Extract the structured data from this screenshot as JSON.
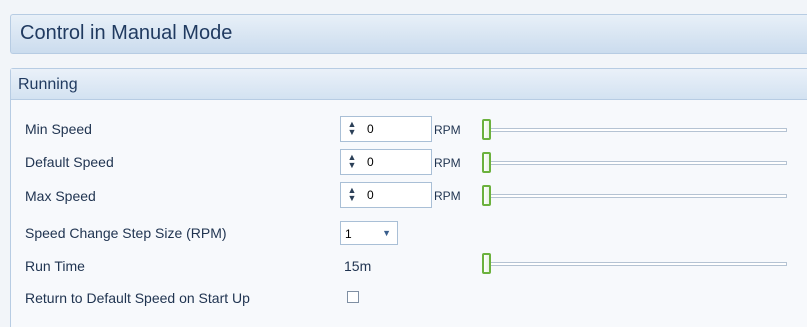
{
  "header": {
    "title": "Control in Manual Mode"
  },
  "section": {
    "title": "Running"
  },
  "rows": [
    {
      "label": "Min Speed",
      "value": "0",
      "unit": "RPM",
      "slider_fraction": 0
    },
    {
      "label": "Default Speed",
      "value": "0",
      "unit": "RPM",
      "slider_fraction": 0
    },
    {
      "label": "Max Speed",
      "value": "0",
      "unit": "RPM",
      "slider_fraction": 0
    }
  ],
  "step_size": {
    "label": "Speed Change Step Size (RPM)",
    "value": "1"
  },
  "run_time": {
    "label": "Run Time",
    "value": "15m",
    "slider_fraction": 0
  },
  "return_default": {
    "label": "Return to Default Speed on Start Up",
    "checked": false
  },
  "colors": {
    "accent": "#6bb13d",
    "header_text": "#203a60",
    "border": "#b7cce3"
  },
  "icons": {
    "spinner": "up-down-arrows-icon",
    "dropdown": "chevron-down-icon",
    "slider_thumb": "slider-thumb-icon"
  }
}
